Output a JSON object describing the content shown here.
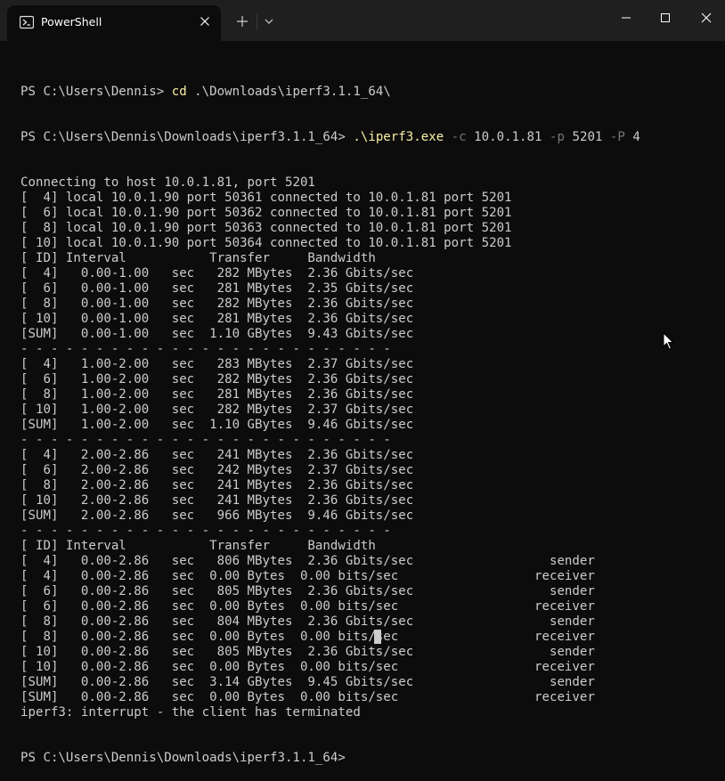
{
  "window": {
    "tab_title": "PowerShell",
    "icons": {
      "tab": "powershell-icon",
      "close_tab": "close-icon",
      "new_tab": "plus-icon",
      "dropdown": "chevron-down-icon",
      "minimize": "minimize-icon",
      "maximize": "maximize-icon",
      "close_window": "close-icon"
    }
  },
  "terminal": {
    "prompt": "PS C:\\Users\\Dennis> ",
    "cmd1_name": "cd",
    "cmd1_arg": " .\\Downloads\\iperf3.1.1_64\\",
    "prompt2": "PS C:\\Users\\Dennis\\Downloads\\iperf3.1.1_64> ",
    "cmd2_name": ".\\iperf3.exe",
    "cmd2_p1": " -c",
    "cmd2_v1": " 10.0.1.81",
    "cmd2_p2": " -p",
    "cmd2_v2": " 5201",
    "cmd2_p3": " -P",
    "cmd2_v3": " 4",
    "output_lines": [
      "Connecting to host 10.0.1.81, port 5201",
      "[  4] local 10.0.1.90 port 50361 connected to 10.0.1.81 port 5201",
      "[  6] local 10.0.1.90 port 50362 connected to 10.0.1.81 port 5201",
      "[  8] local 10.0.1.90 port 50363 connected to 10.0.1.81 port 5201",
      "[ 10] local 10.0.1.90 port 50364 connected to 10.0.1.81 port 5201",
      "[ ID] Interval           Transfer     Bandwidth",
      "[  4]   0.00-1.00   sec   282 MBytes  2.36 Gbits/sec",
      "[  6]   0.00-1.00   sec   281 MBytes  2.35 Gbits/sec",
      "[  8]   0.00-1.00   sec   282 MBytes  2.36 Gbits/sec",
      "[ 10]   0.00-1.00   sec   281 MBytes  2.36 Gbits/sec",
      "[SUM]   0.00-1.00   sec  1.10 GBytes  9.43 Gbits/sec",
      "- - - - - - - - - - - - - - - - - - - - - - - - -",
      "[  4]   1.00-2.00   sec   283 MBytes  2.37 Gbits/sec",
      "[  6]   1.00-2.00   sec   282 MBytes  2.36 Gbits/sec",
      "[  8]   1.00-2.00   sec   281 MBytes  2.36 Gbits/sec",
      "[ 10]   1.00-2.00   sec   282 MBytes  2.37 Gbits/sec",
      "[SUM]   1.00-2.00   sec  1.10 GBytes  9.46 Gbits/sec",
      "- - - - - - - - - - - - - - - - - - - - - - - - -",
      "[  4]   2.00-2.86   sec   241 MBytes  2.36 Gbits/sec",
      "[  6]   2.00-2.86   sec   242 MBytes  2.37 Gbits/sec",
      "[  8]   2.00-2.86   sec   241 MBytes  2.36 Gbits/sec",
      "[ 10]   2.00-2.86   sec   241 MBytes  2.36 Gbits/sec",
      "[SUM]   2.00-2.86   sec   966 MBytes  9.46 Gbits/sec",
      "- - - - - - - - - - - - - - - - - - - - - - - - -",
      "[ ID] Interval           Transfer     Bandwidth",
      "[  4]   0.00-2.86   sec   806 MBytes  2.36 Gbits/sec                  sender",
      "[  4]   0.00-2.86   sec  0.00 Bytes  0.00 bits/sec                  receiver",
      "[  6]   0.00-2.86   sec   805 MBytes  2.36 Gbits/sec                  sender",
      "[  6]   0.00-2.86   sec  0.00 Bytes  0.00 bits/sec                  receiver",
      "[  8]   0.00-2.86   sec   804 MBytes  2.36 Gbits/sec                  sender",
      "[  8]   0.00-2.86   sec  0.00 Bytes  0.00 bits/sec                  receiver",
      "[ 10]   0.00-2.86   sec   805 MBytes  2.36 Gbits/sec                  sender",
      "[ 10]   0.00-2.86   sec  0.00 Bytes  0.00 bits/sec                  receiver",
      "[SUM]   0.00-2.86   sec  3.14 GBytes  9.45 Gbits/sec                  sender",
      "[SUM]   0.00-2.86   sec  0.00 Bytes  0.00 bits/sec                  receiver",
      "iperf3: interrupt - the client has terminated"
    ],
    "final_prompt": "PS C:\\Users\\Dennis\\Downloads\\iperf3.1.1_64> "
  },
  "colors": {
    "background": "#0c0c0c",
    "titlebar": "#1f1f1f",
    "text": "#cccccc",
    "command": "#f9f1a5",
    "parameter": "#767676"
  }
}
